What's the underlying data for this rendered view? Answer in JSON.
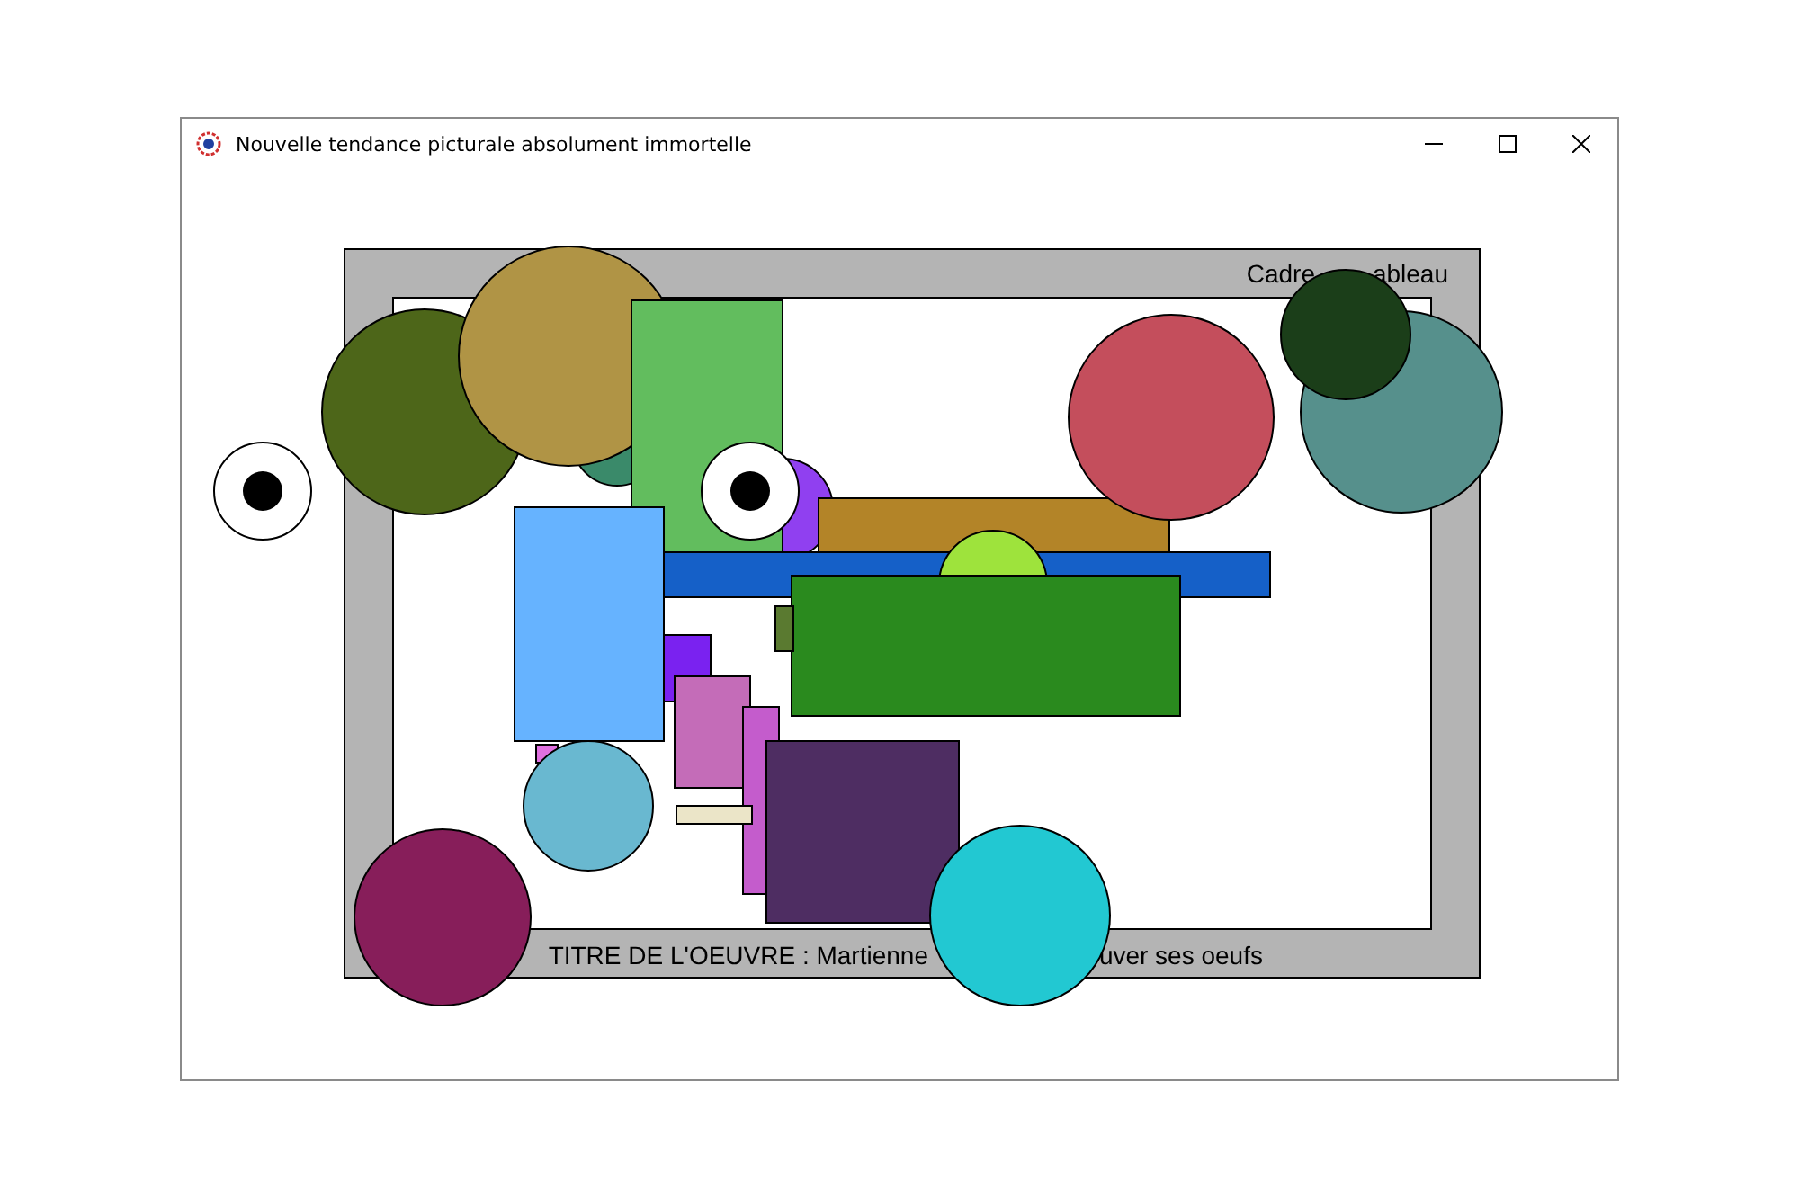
{
  "window": {
    "title": "Nouvelle tendance picturale absolument immortelle"
  },
  "frame": {
    "label_parts": [
      "Cadre",
      "ableau"
    ]
  },
  "artwork_title": {
    "parts": [
      "TITRE DE L'OEUVRE : Martienne",
      "uver ses oeufs"
    ]
  }
}
